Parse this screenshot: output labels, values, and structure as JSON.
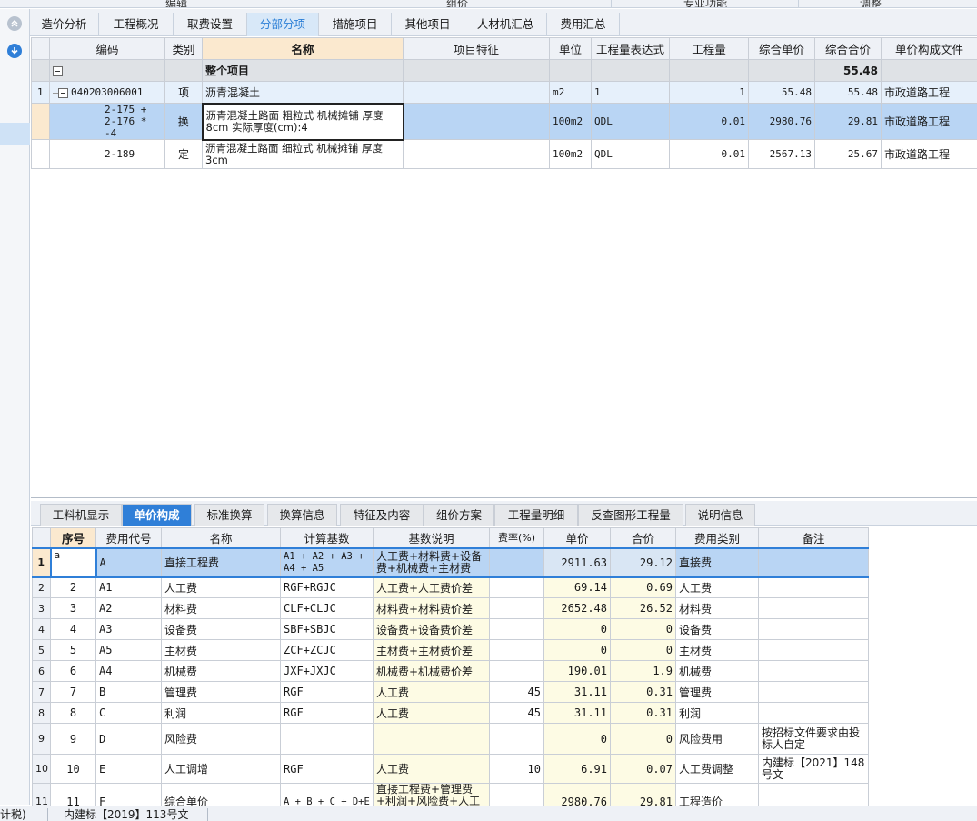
{
  "ribbon": [
    "编辑",
    "组价",
    "专业功能",
    "调整"
  ],
  "tabs": [
    {
      "label": "造价分析",
      "active": false
    },
    {
      "label": "工程概况",
      "active": false
    },
    {
      "label": "取费设置",
      "active": false
    },
    {
      "label": "分部分项",
      "active": true
    },
    {
      "label": "措施项目",
      "active": false
    },
    {
      "label": "其他项目",
      "active": false
    },
    {
      "label": "人材机汇总",
      "active": false
    },
    {
      "label": "费用汇总",
      "active": false
    }
  ],
  "upper": {
    "headers": [
      "编码",
      "类别",
      "名称",
      "项目特征",
      "单位",
      "工程量表达式",
      "工程量",
      "综合单价",
      "综合合价",
      "单价构成文件"
    ],
    "group": {
      "label": "整个项目",
      "total": "55.48"
    },
    "rows": [
      {
        "num": "1",
        "code": "040203006001",
        "type": "项",
        "name": "沥青混凝土",
        "feature": "",
        "unit": "m2",
        "expr": "1",
        "qty": "1",
        "price": "55.48",
        "total": "55.48",
        "file": "市政道路工程"
      },
      {
        "num": "",
        "code": "2-175 + 2-176 * -4",
        "type": "换",
        "name": "沥青混凝土路面 粗粒式 机械摊铺 厚度8cm  实际厚度(cm):4",
        "feature": "",
        "unit": "100m2",
        "expr": "QDL",
        "qty": "0.01",
        "price": "2980.76",
        "total": "29.81",
        "file": "市政道路工程"
      },
      {
        "num": "",
        "code": "2-189",
        "type": "定",
        "name": "沥青混凝土路面 细粒式 机械摊铺 厚度3cm",
        "feature": "",
        "unit": "100m2",
        "expr": "QDL",
        "qty": "0.01",
        "price": "2567.13",
        "total": "25.67",
        "file": "市政道路工程"
      }
    ]
  },
  "bottom_tabs": [
    {
      "label": "工料机显示",
      "active": false
    },
    {
      "label": "单价构成",
      "active": true
    },
    {
      "label": "标准换算",
      "active": false
    },
    {
      "label": "换算信息",
      "active": false
    },
    {
      "label": "特征及内容",
      "active": false
    },
    {
      "label": "组价方案",
      "active": false
    },
    {
      "label": "工程量明细",
      "active": false
    },
    {
      "label": "反查图形工程量",
      "active": false
    },
    {
      "label": "说明信息",
      "active": false
    }
  ],
  "lower": {
    "headers": [
      "序号",
      "费用代号",
      "名称",
      "计算基数",
      "基数说明",
      "费率(%)",
      "单价",
      "合价",
      "费用类别",
      "备注"
    ],
    "rows": [
      {
        "rn": "1",
        "seq": "a",
        "code": "A",
        "name": "直接工程费",
        "base": "A1 + A2 + A3 + A4 + A5",
        "desc": "人工费+材料费+设备费+机械费+主材费",
        "rate": "",
        "price": "2911.63",
        "total": "29.12",
        "cat": "直接费",
        "note": ""
      },
      {
        "rn": "2",
        "seq": "2",
        "code": "A1",
        "name": "人工费",
        "base": "RGF+RGJC",
        "desc": "人工费+人工费价差",
        "rate": "",
        "price": "69.14",
        "total": "0.69",
        "cat": "人工费",
        "note": ""
      },
      {
        "rn": "3",
        "seq": "3",
        "code": "A2",
        "name": "材料费",
        "base": "CLF+CLJC",
        "desc": "材料费+材料费价差",
        "rate": "",
        "price": "2652.48",
        "total": "26.52",
        "cat": "材料费",
        "note": ""
      },
      {
        "rn": "4",
        "seq": "4",
        "code": "A3",
        "name": "设备费",
        "base": "SBF+SBJC",
        "desc": "设备费+设备费价差",
        "rate": "",
        "price": "0",
        "total": "0",
        "cat": "设备费",
        "note": ""
      },
      {
        "rn": "5",
        "seq": "5",
        "code": "A5",
        "name": "主材费",
        "base": "ZCF+ZCJC",
        "desc": "主材费+主材费价差",
        "rate": "",
        "price": "0",
        "total": "0",
        "cat": "主材费",
        "note": ""
      },
      {
        "rn": "6",
        "seq": "6",
        "code": "A4",
        "name": "机械费",
        "base": "JXF+JXJC",
        "desc": "机械费+机械费价差",
        "rate": "",
        "price": "190.01",
        "total": "1.9",
        "cat": "机械费",
        "note": ""
      },
      {
        "rn": "7",
        "seq": "7",
        "code": "B",
        "name": "管理费",
        "base": "RGF",
        "desc": "人工费",
        "rate": "45",
        "price": "31.11",
        "total": "0.31",
        "cat": "管理费",
        "note": ""
      },
      {
        "rn": "8",
        "seq": "8",
        "code": "C",
        "name": "利润",
        "base": "RGF",
        "desc": "人工费",
        "rate": "45",
        "price": "31.11",
        "total": "0.31",
        "cat": "利润",
        "note": ""
      },
      {
        "rn": "9",
        "seq": "9",
        "code": "D",
        "name": "风险费",
        "base": "",
        "desc": "",
        "rate": "",
        "price": "0",
        "total": "0",
        "cat": "风险费用",
        "note": "按招标文件要求由投标人自定"
      },
      {
        "rn": "10",
        "seq": "10",
        "code": "E",
        "name": "人工调增",
        "base": "RGF",
        "desc": "人工费",
        "rate": "10",
        "price": "6.91",
        "total": "0.07",
        "cat": "人工费调整",
        "note": "内建标【2021】148号文"
      },
      {
        "rn": "11",
        "seq": "11",
        "code": "F",
        "name": "综合单价",
        "base": "A + B + C + D+E",
        "desc": "直接工程费+管理费+利润+风险费+人工调增",
        "rate": "",
        "price": "2980.76",
        "total": "29.81",
        "cat": "工程造价",
        "note": ""
      }
    ]
  },
  "status": [
    "计税)",
    "内建标【2019】113号文"
  ]
}
